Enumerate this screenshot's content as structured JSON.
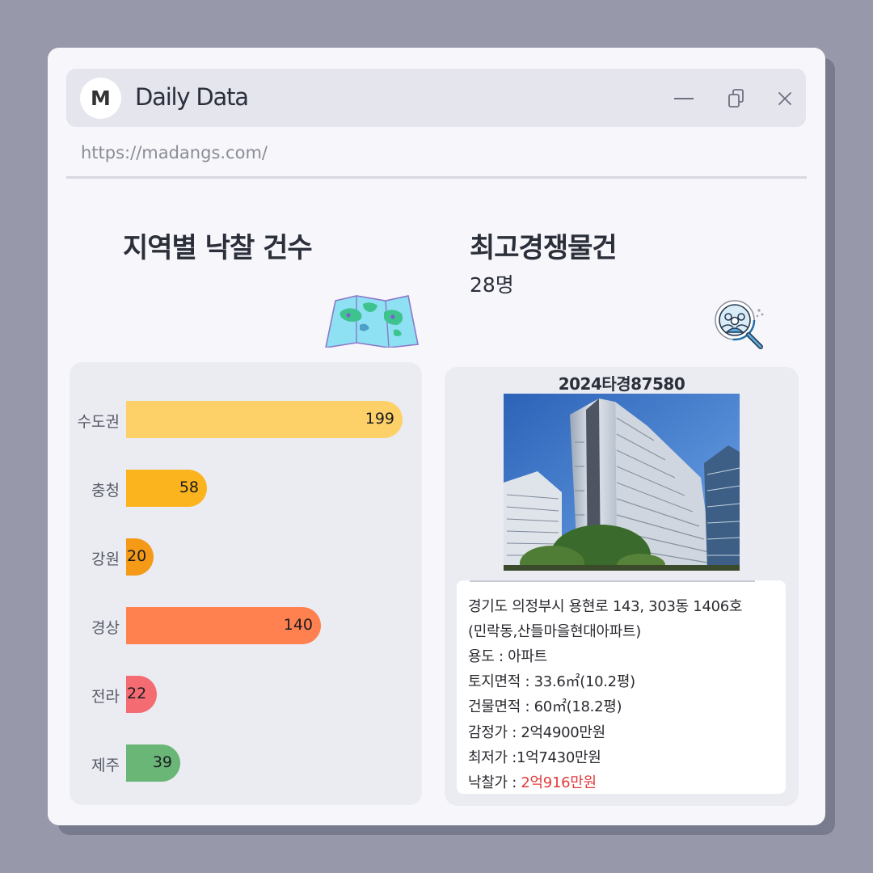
{
  "window": {
    "avatar_letter": "M",
    "title": "Daily Data",
    "url": "https://madangs.com/"
  },
  "left": {
    "heading": "지역별 낙찰 건수",
    "map_icon": "folded-map-icon"
  },
  "right": {
    "heading": "최고경쟁물건",
    "subheading": "28명",
    "icon": "people-search-icon"
  },
  "chart_data": {
    "type": "bar",
    "orientation": "horizontal",
    "title": "",
    "categories": [
      "수도권",
      "충청",
      "강원",
      "경상",
      "전라",
      "제주"
    ],
    "values": [
      199,
      58,
      20,
      140,
      22,
      39
    ],
    "colors": [
      "#fdd168",
      "#fbb41d",
      "#f49a17",
      "#ff8150",
      "#f46b72",
      "#6ab677"
    ]
  },
  "property": {
    "case_no": "2024타경87580",
    "address_line1": "경기도 의정부시 용현로 143, 303동 1406호",
    "address_line2": "(민락동,산들마을현대아파트)",
    "use_label": "용도 : ",
    "use_value": "아파트",
    "land_label": "토지면적 : ",
    "land_value": "33.6㎡(10.2평)",
    "building_label": "건물면적 : ",
    "building_value": "60㎡(18.2평)",
    "appraisal_label": "감정가 : ",
    "appraisal_value": "2억4900만원",
    "minimum_label": "최저가 :",
    "minimum_value": "1억7430만원",
    "winning_label": "낙찰가 : ",
    "winning_value": "2억916만원"
  }
}
